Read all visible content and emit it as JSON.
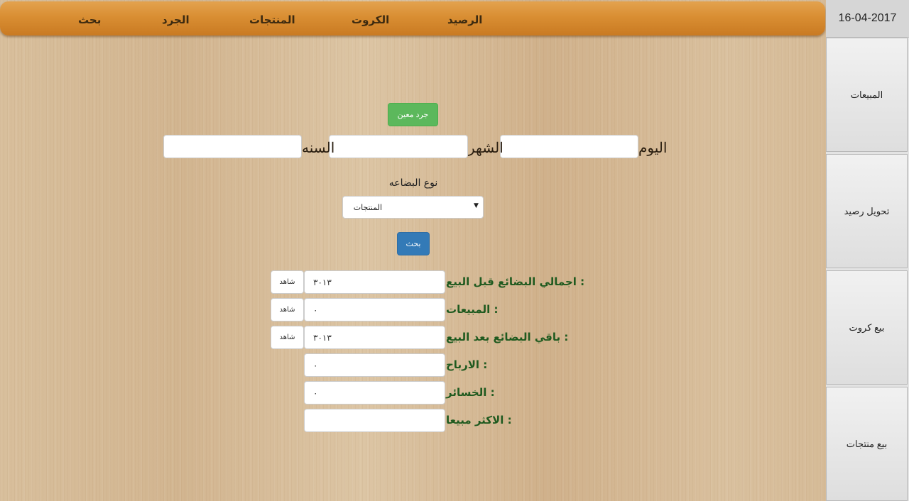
{
  "nav": {
    "items": [
      {
        "label": "الرصيد"
      },
      {
        "label": "الكروت"
      },
      {
        "label": "المنتجات"
      },
      {
        "label": "الجرد"
      },
      {
        "label": "بحث"
      }
    ]
  },
  "sidebar": {
    "date": "16-04-2017",
    "items": [
      {
        "label": "المبيعات"
      },
      {
        "label": "تحويل رصيد"
      },
      {
        "label": "بيع كروت"
      },
      {
        "label": "بيع منتجات"
      }
    ]
  },
  "form": {
    "specific_inventory_button": "جرد معين",
    "day_label": "اليوم",
    "month_label": "الشهر",
    "year_label": "السنه",
    "day_value": "",
    "month_value": "",
    "year_value": "",
    "goods_type_label": "نوع البضاعه",
    "goods_type_selected": "المنتجات",
    "search_button": "بحث"
  },
  "stats": {
    "view_label": "شاهد",
    "rows": [
      {
        "label": "اجمالي البضائع قبل البيع :",
        "value": "٣٠١٣"
      },
      {
        "label": "المبيعات :",
        "value": "٠"
      },
      {
        "label": "باقي البضائع بعد البيع :",
        "value": "٣٠١٣"
      },
      {
        "label": "الارباح :",
        "value": "٠"
      },
      {
        "label": "الخسائر :",
        "value": "٠"
      },
      {
        "label": "الاكثر مبيعا :",
        "value": ""
      }
    ]
  },
  "colors": {
    "nav_orange": "#d98e33",
    "green_button": "#5cb85c",
    "blue_button": "#337ab7",
    "label_green": "#1f5a1f",
    "sidebar_gray": "#e3e3e3"
  }
}
